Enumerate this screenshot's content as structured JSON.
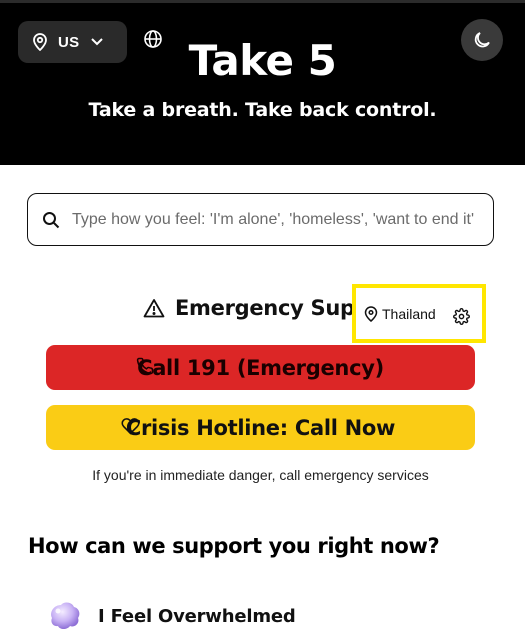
{
  "header": {
    "app_title": "Take 5",
    "tagline": "Take a breath. Take back control.",
    "region_code": "US",
    "icons": [
      "location-pin-icon",
      "chevron-down-icon",
      "globe-icon",
      "moon-icon"
    ]
  },
  "search": {
    "placeholder": "Type how you feel: 'I'm alone', 'homeless', 'want to end it'",
    "value": ""
  },
  "emergency": {
    "heading": "Emergency Support",
    "location_label": "Thailand",
    "call_emergency_label": "Call 191 (Emergency)",
    "crisis_hotline_label": "Crisis Hotline: Call Now",
    "note": "If you're in immediate danger, call emergency services"
  },
  "support": {
    "heading": "How can we support you right now?",
    "options": [
      {
        "label": "I Feel Overwhelmed",
        "icon": "purple-blob-icon"
      }
    ]
  },
  "colors": {
    "header_bg": "#000000",
    "emergency_button": "#dc2626",
    "crisis_button": "#facc15",
    "highlight_border": "#ffe600"
  }
}
